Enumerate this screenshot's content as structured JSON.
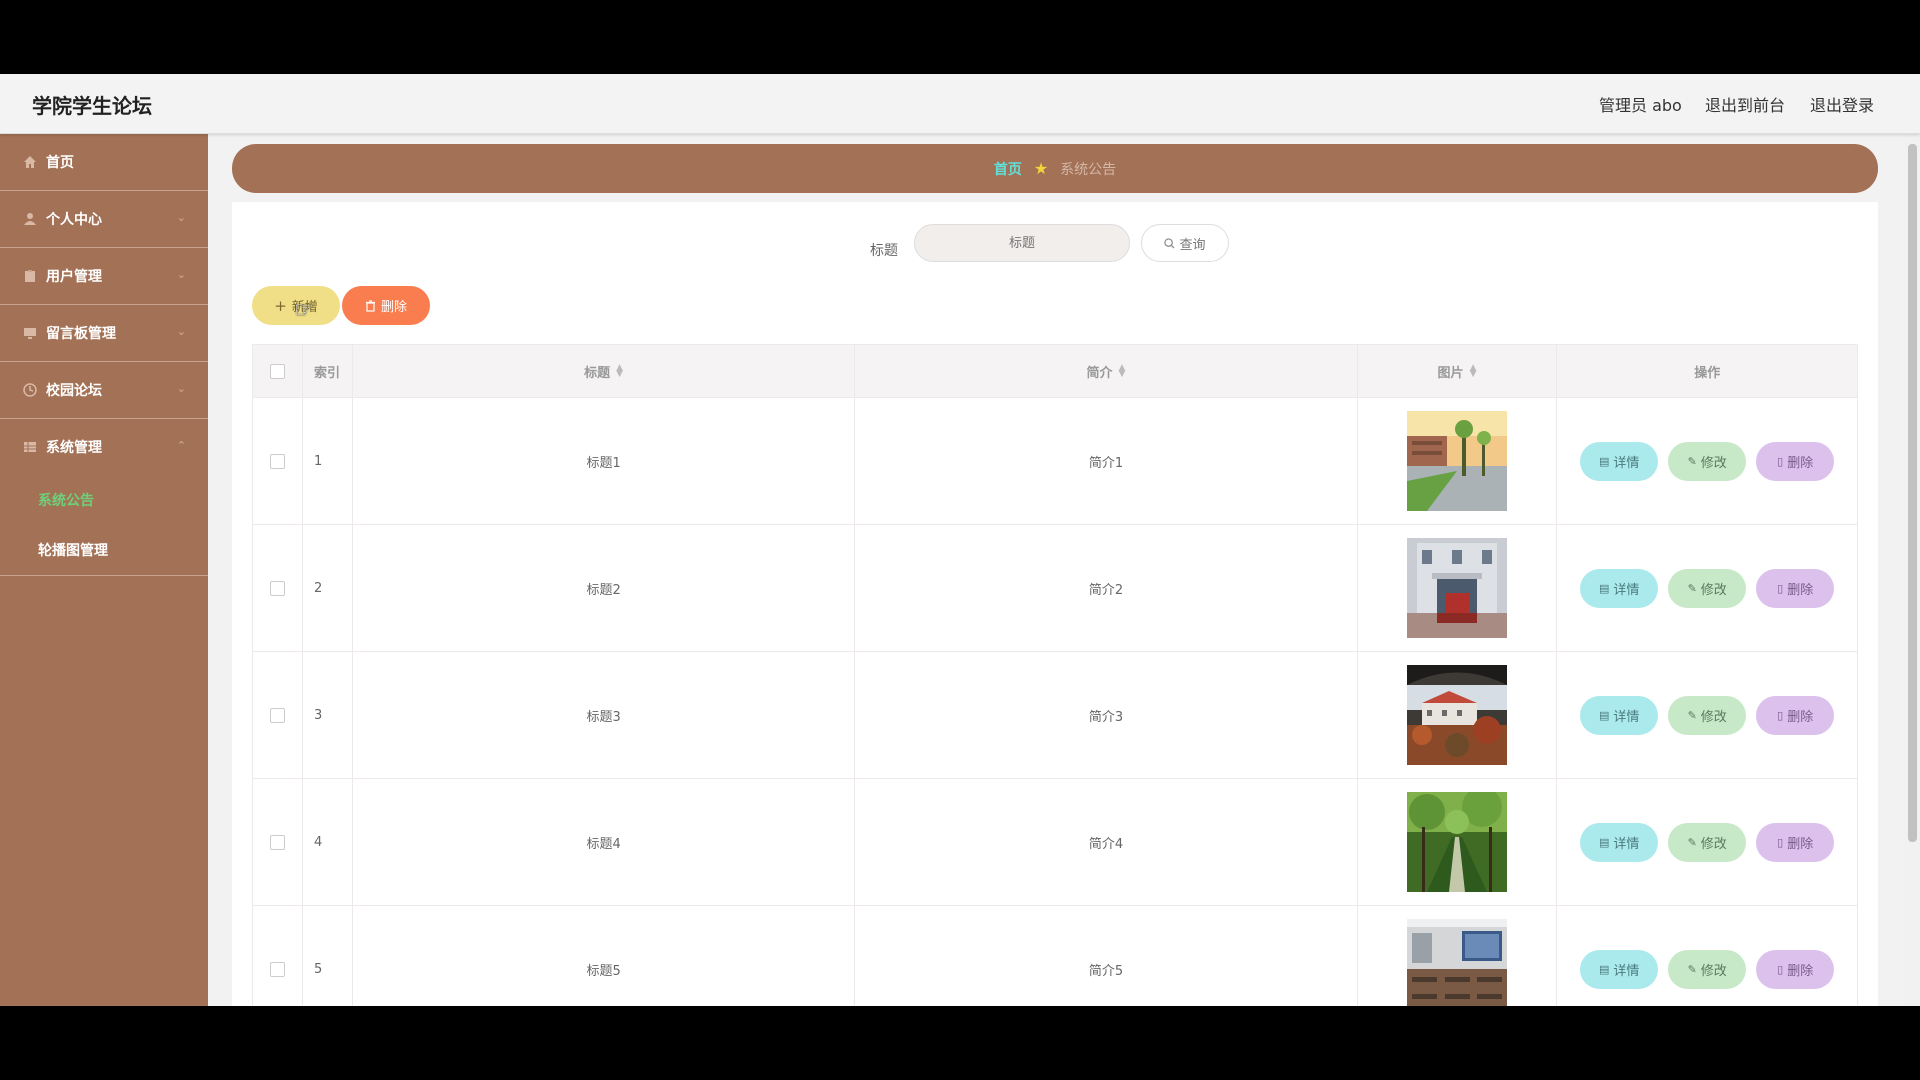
{
  "header": {
    "site_title": "学院学生论坛",
    "admin_label": "管理员 abo",
    "to_frontend": "退出到前台",
    "logout": "退出登录"
  },
  "sidebar": {
    "items": [
      {
        "label": "首页",
        "icon": "home-icon"
      },
      {
        "label": "个人中心",
        "icon": "user-icon"
      },
      {
        "label": "用户管理",
        "icon": "clipboard-icon"
      },
      {
        "label": "留言板管理",
        "icon": "monitor-icon"
      },
      {
        "label": "校园论坛",
        "icon": "clock-icon"
      },
      {
        "label": "系统管理",
        "icon": "grid-icon"
      }
    ],
    "sub_items": [
      {
        "label": "系统公告",
        "active": true
      },
      {
        "label": "轮播图管理",
        "active": false
      }
    ]
  },
  "breadcrumb": {
    "home": "首页",
    "current": "系统公告"
  },
  "search": {
    "label": "标题",
    "placeholder": "标题",
    "query_button": "查询"
  },
  "toolbar": {
    "add_label": "新增",
    "delete_label": "删除"
  },
  "table": {
    "headers": {
      "index": "索引",
      "title": "标题",
      "intro": "简介",
      "image": "图片",
      "ops": "操作"
    },
    "rows": [
      {
        "index": "1",
        "title": "标题1",
        "intro": "简介1"
      },
      {
        "index": "2",
        "title": "标题2",
        "intro": "简介2"
      },
      {
        "index": "3",
        "title": "标题3",
        "intro": "简介3"
      },
      {
        "index": "4",
        "title": "标题4",
        "intro": "简介4"
      },
      {
        "index": "5",
        "title": "标题5",
        "intro": "简介5"
      }
    ],
    "ops": {
      "detail": "详情",
      "edit": "修改",
      "delete": "删除"
    }
  },
  "colors": {
    "sidebar_bg": "#a37156",
    "breadcrumb_home": "#5fe0d8",
    "active_submenu": "#6ed07a",
    "add_button": "#f0df86",
    "delete_button": "#f97d4e",
    "detail_button": "#aae9ec",
    "edit_button": "#c7e9c8",
    "row_delete_button": "#dcc1ec"
  }
}
